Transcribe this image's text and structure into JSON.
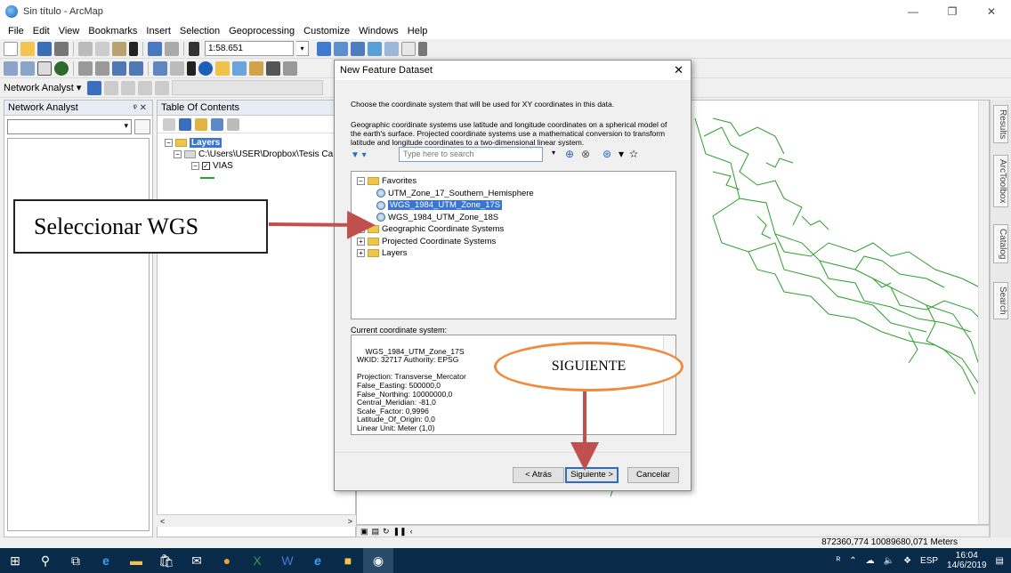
{
  "window": {
    "title": "Sin título - ArcMap",
    "controls": [
      "—",
      "❐",
      "✕"
    ]
  },
  "menu": [
    "File",
    "Edit",
    "View",
    "Bookmarks",
    "Insert",
    "Selection",
    "Geoprocessing",
    "Customize",
    "Windows",
    "Help"
  ],
  "toolbar": {
    "scale": "1:58.651",
    "network_analyst_label": "Network Analyst ▾"
  },
  "network_analyst": {
    "title": "Network Analyst",
    "pin": "ᵠ ✕"
  },
  "toc": {
    "title": "Table Of Contents",
    "root": "Layers",
    "path": "C:\\Users\\USER\\Dropbox\\Tesis Ca",
    "layer": "VIAS"
  },
  "dialog": {
    "title": "New Feature Dataset",
    "intro": "Choose the coordinate system that will be used for XY coordinates in this data.",
    "desc": "Geographic coordinate systems use latitude and longitude coordinates on a spherical model of the earth's surface. Projected coordinate systems use a mathematical conversion to transform latitude and longitude coordinates to a two-dimensional linear system.",
    "search_placeholder": "Type here to search",
    "tree": {
      "favorites": "Favorites",
      "items": [
        "UTM_Zone_17_Southern_Hemisphere",
        "WGS_1984_UTM_Zone_17S",
        "WGS_1984_UTM_Zone_18S"
      ],
      "groups": [
        "Geographic Coordinate Systems",
        "Projected Coordinate Systems",
        "Layers"
      ]
    },
    "current_label": "Current coordinate system:",
    "current_text": "WGS_1984_UTM_Zone_17S\nWKID: 32717 Authority: EPSG\n\nProjection: Transverse_Mercator\nFalse_Easting: 500000,0\nFalse_Northing: 10000000,0\nCentral_Meridian: -81,0\nScale_Factor: 0,9996\nLatitude_Of_Origin: 0,0\nLinear Unit: Meter (1,0)",
    "buttons": {
      "back": "< Atrás",
      "next": "Siguiente >",
      "cancel": "Cancelar"
    }
  },
  "annotations": {
    "box": "Seleccionar WGS",
    "oval": "SIGUIENTE"
  },
  "dock_tabs": [
    "Results",
    "ArcToolbox",
    "Catalog",
    "Search"
  ],
  "status": {
    "coords": "872360,774  10089680,071 Meters"
  },
  "taskbar": {
    "lang": "ESP",
    "time": "16:04",
    "date": "14/6/2019"
  },
  "colors": {
    "map_lines": "#2ca02c",
    "selection": "#3875d7",
    "oval": "#f08a3c",
    "arrow": "#c0504d"
  }
}
